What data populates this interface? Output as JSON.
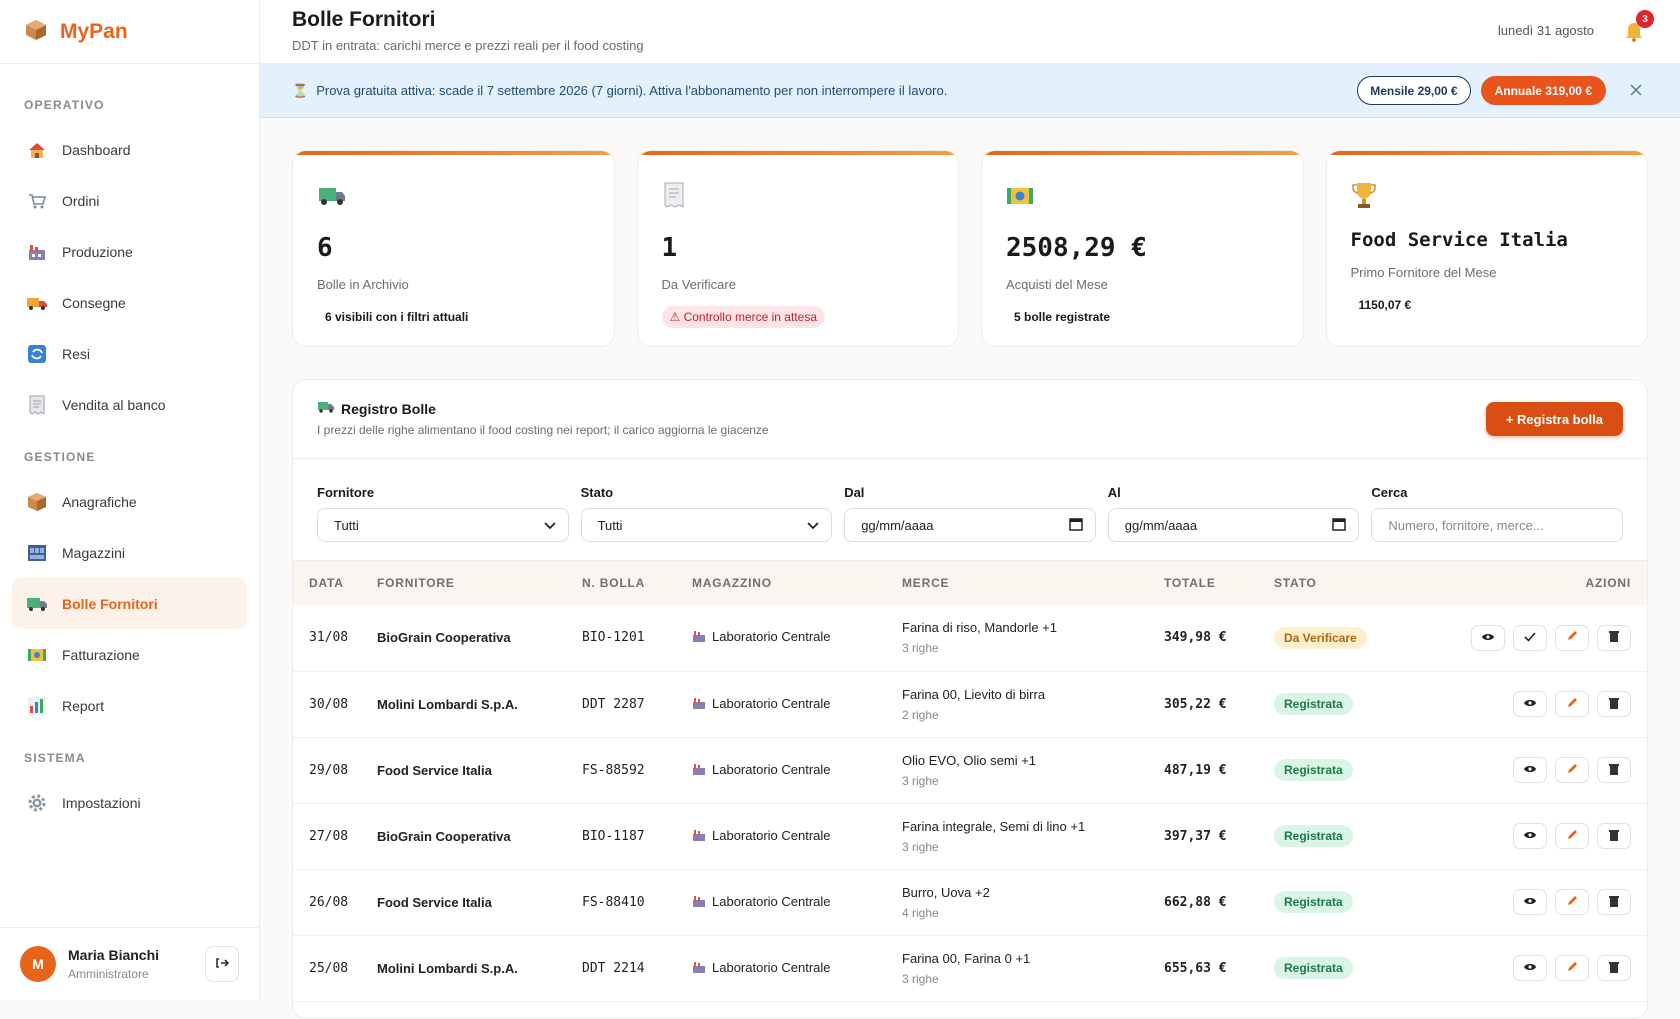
{
  "brand": {
    "name": "MyPan"
  },
  "sidebar": {
    "sections": [
      {
        "title": "OPERATIVO",
        "items": [
          {
            "label": "Dashboard",
            "icon": "house-icon"
          },
          {
            "label": "Ordini",
            "icon": "cart-icon"
          },
          {
            "label": "Produzione",
            "icon": "factory-icon"
          },
          {
            "label": "Consegne",
            "icon": "truck-icon"
          },
          {
            "label": "Resi",
            "icon": "return-icon"
          },
          {
            "label": "Vendita al banco",
            "icon": "receipt-icon"
          }
        ]
      },
      {
        "title": "GESTIONE",
        "items": [
          {
            "label": "Anagrafiche",
            "icon": "box-icon"
          },
          {
            "label": "Magazzini",
            "icon": "warehouse-icon"
          },
          {
            "label": "Bolle Fornitori",
            "icon": "delivery-truck-icon",
            "active": true
          },
          {
            "label": "Fatturazione",
            "icon": "money-icon"
          },
          {
            "label": "Report",
            "icon": "chart-icon"
          }
        ]
      },
      {
        "title": "SISTEMA",
        "items": [
          {
            "label": "Impostazioni",
            "icon": "gear-icon"
          }
        ]
      }
    ]
  },
  "user": {
    "initial": "M",
    "name": "Maria Bianchi",
    "role": "Amministratore"
  },
  "header": {
    "title": "Bolle Fornitori",
    "subtitle": "DDT in entrata: carichi merce e prezzi reali per il food costing",
    "date": "lunedì 31 agosto",
    "notifications": "3"
  },
  "trial": {
    "icon": "⏳",
    "text": "Prova gratuita attiva: scade il 7 settembre 2026 (7 giorni). Attiva l'abbonamento per non interrompere il lavoro.",
    "monthly": "Mensile 29,00 €",
    "annual": "Annuale 319,00 €"
  },
  "kpis": [
    {
      "value": "6",
      "label": "Bolle in Archivio",
      "note": "6 visibili con i filtri attuali"
    },
    {
      "value": "1",
      "label": "Da Verificare",
      "note": "⚠ Controllo merce in attesa"
    },
    {
      "value": "2508,29 €",
      "label": "Acquisti del Mese",
      "note": "5 bolle registrate"
    },
    {
      "value": "Food Service Italia",
      "label": "Primo Fornitore del Mese",
      "note": "1150,07 €"
    }
  ],
  "registry": {
    "title": "Registro Bolle",
    "subtitle": "I prezzi delle righe alimentano il food costing nei report; il carico aggiorna le giacenze",
    "add_button": "+ Registra bolla",
    "filters": {
      "fornitore_label": "Fornitore",
      "fornitore_value": "Tutti",
      "stato_label": "Stato",
      "stato_value": "Tutti",
      "dal_label": "Dal",
      "dal_placeholder": "gg/mm/aaaa",
      "al_label": "Al",
      "al_placeholder": "gg/mm/aaaa",
      "cerca_label": "Cerca",
      "cerca_placeholder": "Numero, fornitore, merce..."
    },
    "columns": [
      "DATA",
      "FORNITORE",
      "N. BOLLA",
      "MAGAZZINO",
      "MERCE",
      "TOTALE",
      "STATO",
      "AZIONI"
    ],
    "rows": [
      {
        "date": "31/08",
        "supplier": "BioGrain Cooperativa",
        "number": "BIO-1201",
        "warehouse": "Laboratorio Centrale",
        "goods": "Farina di riso, Mandorle +1",
        "lines": "3 righe",
        "total": "349,98 €",
        "status": "Da Verificare",
        "pending": true
      },
      {
        "date": "30/08",
        "supplier": "Molini Lombardi S.p.A.",
        "number": "DDT 2287",
        "warehouse": "Laboratorio Centrale",
        "goods": "Farina 00, Lievito di birra",
        "lines": "2 righe",
        "total": "305,22 €",
        "status": "Registrata"
      },
      {
        "date": "29/08",
        "supplier": "Food Service Italia",
        "number": "FS-88592",
        "warehouse": "Laboratorio Centrale",
        "goods": "Olio EVO, Olio semi +1",
        "lines": "3 righe",
        "total": "487,19 €",
        "status": "Registrata"
      },
      {
        "date": "27/08",
        "supplier": "BioGrain Cooperativa",
        "number": "BIO-1187",
        "warehouse": "Laboratorio Centrale",
        "goods": "Farina integrale, Semi di lino +1",
        "lines": "3 righe",
        "total": "397,37 €",
        "status": "Registrata"
      },
      {
        "date": "26/08",
        "supplier": "Food Service Italia",
        "number": "FS-88410",
        "warehouse": "Laboratorio Centrale",
        "goods": "Burro, Uova +2",
        "lines": "4 righe",
        "total": "662,88 €",
        "status": "Registrata"
      },
      {
        "date": "25/08",
        "supplier": "Molini Lombardi S.p.A.",
        "number": "DDT 2214",
        "warehouse": "Laboratorio Centrale",
        "goods": "Farina 00, Farina 0 +1",
        "lines": "3 righe",
        "total": "655,63 €",
        "status": "Registrata"
      }
    ]
  },
  "colors": {
    "accent": "#e8641b",
    "trial_bg": "#e4f1fc",
    "pending": "#fdf0cf",
    "ok": "#d9f5e6"
  }
}
